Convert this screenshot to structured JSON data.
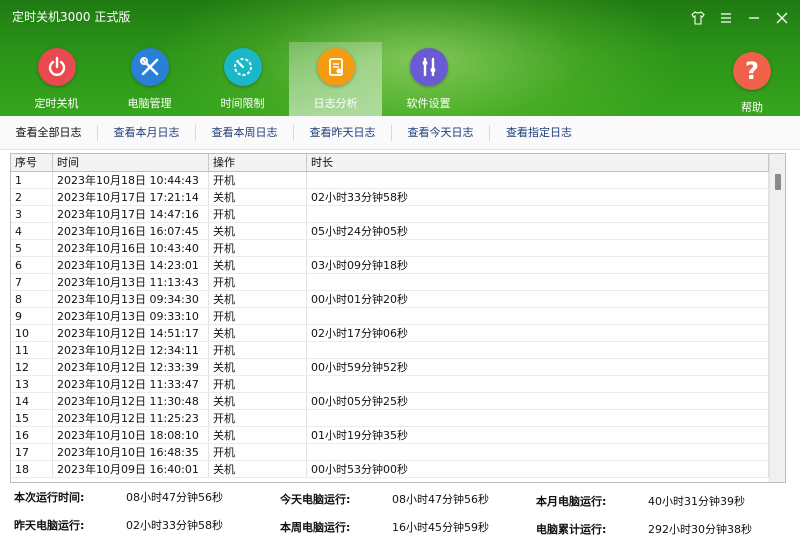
{
  "window": {
    "title": "定时关机3000 正式版",
    "controls": [
      "shirt-icon",
      "menu-icon",
      "minimize-icon",
      "close-icon"
    ]
  },
  "nav": {
    "items": [
      {
        "label": "定时关机",
        "icon": "power-icon",
        "color": "#e84a4f"
      },
      {
        "label": "电脑管理",
        "icon": "tools-icon",
        "color": "#2a7fd6"
      },
      {
        "label": "时间限制",
        "icon": "timer-icon",
        "color": "#1bb7c9"
      },
      {
        "label": "日志分析",
        "icon": "log-icon",
        "color": "#f39c12",
        "active": true
      },
      {
        "label": "软件设置",
        "icon": "settings-icon",
        "color": "#6b5bd2"
      }
    ],
    "help": {
      "label": "帮助",
      "icon": "help-icon",
      "color": "#f0614a"
    }
  },
  "subtabs": [
    "查看全部日志",
    "查看本月日志",
    "查看本周日志",
    "查看昨天日志",
    "查看今天日志",
    "查看指定日志"
  ],
  "table": {
    "headers": [
      "序号",
      "时间",
      "操作",
      "时长"
    ],
    "rows": [
      [
        "1",
        "2023年10月18日 10:44:43",
        "开机",
        ""
      ],
      [
        "2",
        "2023年10月17日 17:21:14",
        "关机",
        "02小时33分钟58秒"
      ],
      [
        "3",
        "2023年10月17日 14:47:16",
        "开机",
        ""
      ],
      [
        "4",
        "2023年10月16日 16:07:45",
        "关机",
        "05小时24分钟05秒"
      ],
      [
        "5",
        "2023年10月16日 10:43:40",
        "开机",
        ""
      ],
      [
        "6",
        "2023年10月13日 14:23:01",
        "关机",
        "03小时09分钟18秒"
      ],
      [
        "7",
        "2023年10月13日 11:13:43",
        "开机",
        ""
      ],
      [
        "8",
        "2023年10月13日 09:34:30",
        "关机",
        "00小时01分钟20秒"
      ],
      [
        "9",
        "2023年10月13日 09:33:10",
        "开机",
        ""
      ],
      [
        "10",
        "2023年10月12日 14:51:17",
        "关机",
        "02小时17分钟06秒"
      ],
      [
        "11",
        "2023年10月12日 12:34:11",
        "开机",
        ""
      ],
      [
        "12",
        "2023年10月12日 12:33:39",
        "关机",
        "00小时59分钟52秒"
      ],
      [
        "13",
        "2023年10月12日 11:33:47",
        "开机",
        ""
      ],
      [
        "14",
        "2023年10月12日 11:30:48",
        "关机",
        "00小时05分钟25秒"
      ],
      [
        "15",
        "2023年10月12日 11:25:23",
        "开机",
        ""
      ],
      [
        "16",
        "2023年10月10日 18:08:10",
        "关机",
        "01小时19分钟35秒"
      ],
      [
        "17",
        "2023年10月10日 16:48:35",
        "开机",
        ""
      ],
      [
        "18",
        "2023年10月09日 16:40:01",
        "关机",
        "00小时53分钟00秒"
      ]
    ]
  },
  "stats": [
    {
      "label": "本次运行时间:",
      "value": "08小时47分钟56秒"
    },
    {
      "label": "今天电脑运行:",
      "value": "08小时47分钟56秒"
    },
    {
      "label": "本月电脑运行:",
      "value": "40小时31分钟39秒"
    },
    {
      "label": "昨天电脑运行:",
      "value": "02小时33分钟58秒"
    },
    {
      "label": "本周电脑运行:",
      "value": "16小时45分钟59秒"
    },
    {
      "label": "电脑累计运行:",
      "value": "292小时30分钟38秒"
    }
  ]
}
